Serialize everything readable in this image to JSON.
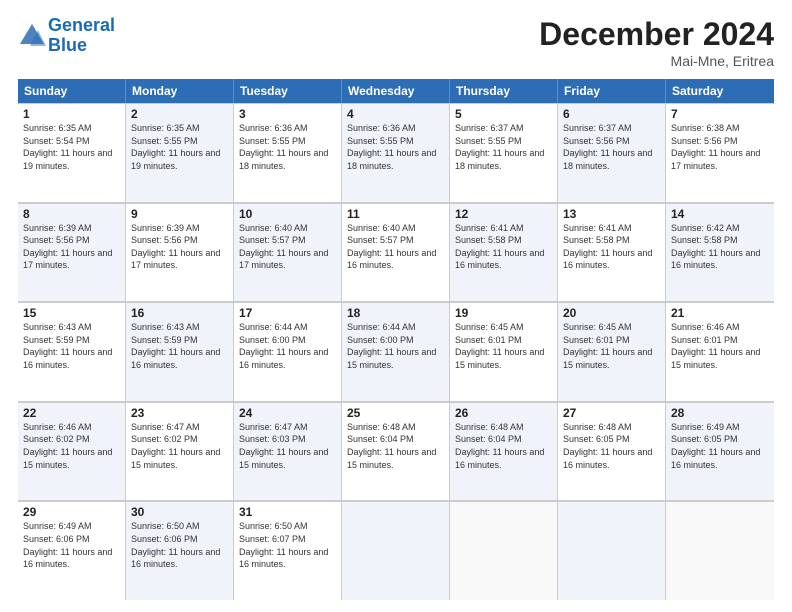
{
  "header": {
    "logo_line1": "General",
    "logo_line2": "Blue",
    "month": "December 2024",
    "location": "Mai-Mne, Eritrea"
  },
  "weekdays": [
    "Sunday",
    "Monday",
    "Tuesday",
    "Wednesday",
    "Thursday",
    "Friday",
    "Saturday"
  ],
  "rows": [
    [
      {
        "day": "1",
        "sunrise": "Sunrise: 6:35 AM",
        "sunset": "Sunset: 5:54 PM",
        "daylight": "Daylight: 11 hours and 19 minutes.",
        "shaded": false
      },
      {
        "day": "2",
        "sunrise": "Sunrise: 6:35 AM",
        "sunset": "Sunset: 5:55 PM",
        "daylight": "Daylight: 11 hours and 19 minutes.",
        "shaded": true
      },
      {
        "day": "3",
        "sunrise": "Sunrise: 6:36 AM",
        "sunset": "Sunset: 5:55 PM",
        "daylight": "Daylight: 11 hours and 18 minutes.",
        "shaded": false
      },
      {
        "day": "4",
        "sunrise": "Sunrise: 6:36 AM",
        "sunset": "Sunset: 5:55 PM",
        "daylight": "Daylight: 11 hours and 18 minutes.",
        "shaded": true
      },
      {
        "day": "5",
        "sunrise": "Sunrise: 6:37 AM",
        "sunset": "Sunset: 5:55 PM",
        "daylight": "Daylight: 11 hours and 18 minutes.",
        "shaded": false
      },
      {
        "day": "6",
        "sunrise": "Sunrise: 6:37 AM",
        "sunset": "Sunset: 5:56 PM",
        "daylight": "Daylight: 11 hours and 18 minutes.",
        "shaded": true
      },
      {
        "day": "7",
        "sunrise": "Sunrise: 6:38 AM",
        "sunset": "Sunset: 5:56 PM",
        "daylight": "Daylight: 11 hours and 17 minutes.",
        "shaded": false
      }
    ],
    [
      {
        "day": "8",
        "sunrise": "Sunrise: 6:39 AM",
        "sunset": "Sunset: 5:56 PM",
        "daylight": "Daylight: 11 hours and 17 minutes.",
        "shaded": true
      },
      {
        "day": "9",
        "sunrise": "Sunrise: 6:39 AM",
        "sunset": "Sunset: 5:56 PM",
        "daylight": "Daylight: 11 hours and 17 minutes.",
        "shaded": false
      },
      {
        "day": "10",
        "sunrise": "Sunrise: 6:40 AM",
        "sunset": "Sunset: 5:57 PM",
        "daylight": "Daylight: 11 hours and 17 minutes.",
        "shaded": true
      },
      {
        "day": "11",
        "sunrise": "Sunrise: 6:40 AM",
        "sunset": "Sunset: 5:57 PM",
        "daylight": "Daylight: 11 hours and 16 minutes.",
        "shaded": false
      },
      {
        "day": "12",
        "sunrise": "Sunrise: 6:41 AM",
        "sunset": "Sunset: 5:58 PM",
        "daylight": "Daylight: 11 hours and 16 minutes.",
        "shaded": true
      },
      {
        "day": "13",
        "sunrise": "Sunrise: 6:41 AM",
        "sunset": "Sunset: 5:58 PM",
        "daylight": "Daylight: 11 hours and 16 minutes.",
        "shaded": false
      },
      {
        "day": "14",
        "sunrise": "Sunrise: 6:42 AM",
        "sunset": "Sunset: 5:58 PM",
        "daylight": "Daylight: 11 hours and 16 minutes.",
        "shaded": true
      }
    ],
    [
      {
        "day": "15",
        "sunrise": "Sunrise: 6:43 AM",
        "sunset": "Sunset: 5:59 PM",
        "daylight": "Daylight: 11 hours and 16 minutes.",
        "shaded": false
      },
      {
        "day": "16",
        "sunrise": "Sunrise: 6:43 AM",
        "sunset": "Sunset: 5:59 PM",
        "daylight": "Daylight: 11 hours and 16 minutes.",
        "shaded": true
      },
      {
        "day": "17",
        "sunrise": "Sunrise: 6:44 AM",
        "sunset": "Sunset: 6:00 PM",
        "daylight": "Daylight: 11 hours and 16 minutes.",
        "shaded": false
      },
      {
        "day": "18",
        "sunrise": "Sunrise: 6:44 AM",
        "sunset": "Sunset: 6:00 PM",
        "daylight": "Daylight: 11 hours and 15 minutes.",
        "shaded": true
      },
      {
        "day": "19",
        "sunrise": "Sunrise: 6:45 AM",
        "sunset": "Sunset: 6:01 PM",
        "daylight": "Daylight: 11 hours and 15 minutes.",
        "shaded": false
      },
      {
        "day": "20",
        "sunrise": "Sunrise: 6:45 AM",
        "sunset": "Sunset: 6:01 PM",
        "daylight": "Daylight: 11 hours and 15 minutes.",
        "shaded": true
      },
      {
        "day": "21",
        "sunrise": "Sunrise: 6:46 AM",
        "sunset": "Sunset: 6:01 PM",
        "daylight": "Daylight: 11 hours and 15 minutes.",
        "shaded": false
      }
    ],
    [
      {
        "day": "22",
        "sunrise": "Sunrise: 6:46 AM",
        "sunset": "Sunset: 6:02 PM",
        "daylight": "Daylight: 11 hours and 15 minutes.",
        "shaded": true
      },
      {
        "day": "23",
        "sunrise": "Sunrise: 6:47 AM",
        "sunset": "Sunset: 6:02 PM",
        "daylight": "Daylight: 11 hours and 15 minutes.",
        "shaded": false
      },
      {
        "day": "24",
        "sunrise": "Sunrise: 6:47 AM",
        "sunset": "Sunset: 6:03 PM",
        "daylight": "Daylight: 11 hours and 15 minutes.",
        "shaded": true
      },
      {
        "day": "25",
        "sunrise": "Sunrise: 6:48 AM",
        "sunset": "Sunset: 6:04 PM",
        "daylight": "Daylight: 11 hours and 15 minutes.",
        "shaded": false
      },
      {
        "day": "26",
        "sunrise": "Sunrise: 6:48 AM",
        "sunset": "Sunset: 6:04 PM",
        "daylight": "Daylight: 11 hours and 16 minutes.",
        "shaded": true
      },
      {
        "day": "27",
        "sunrise": "Sunrise: 6:48 AM",
        "sunset": "Sunset: 6:05 PM",
        "daylight": "Daylight: 11 hours and 16 minutes.",
        "shaded": false
      },
      {
        "day": "28",
        "sunrise": "Sunrise: 6:49 AM",
        "sunset": "Sunset: 6:05 PM",
        "daylight": "Daylight: 11 hours and 16 minutes.",
        "shaded": true
      }
    ],
    [
      {
        "day": "29",
        "sunrise": "Sunrise: 6:49 AM",
        "sunset": "Sunset: 6:06 PM",
        "daylight": "Daylight: 11 hours and 16 minutes.",
        "shaded": false
      },
      {
        "day": "30",
        "sunrise": "Sunrise: 6:50 AM",
        "sunset": "Sunset: 6:06 PM",
        "daylight": "Daylight: 11 hours and 16 minutes.",
        "shaded": true
      },
      {
        "day": "31",
        "sunrise": "Sunrise: 6:50 AM",
        "sunset": "Sunset: 6:07 PM",
        "daylight": "Daylight: 11 hours and 16 minutes.",
        "shaded": false
      },
      {
        "day": "",
        "sunrise": "",
        "sunset": "",
        "daylight": "",
        "shaded": true,
        "empty": true
      },
      {
        "day": "",
        "sunrise": "",
        "sunset": "",
        "daylight": "",
        "shaded": false,
        "empty": true
      },
      {
        "day": "",
        "sunrise": "",
        "sunset": "",
        "daylight": "",
        "shaded": true,
        "empty": true
      },
      {
        "day": "",
        "sunrise": "",
        "sunset": "",
        "daylight": "",
        "shaded": false,
        "empty": true
      }
    ]
  ]
}
